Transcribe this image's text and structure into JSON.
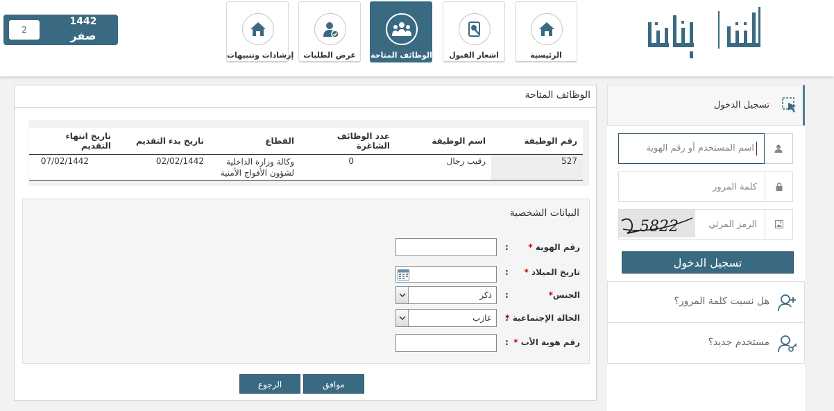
{
  "header": {
    "date": {
      "count": "2",
      "year": "1442",
      "month": "صفر"
    },
    "logo_text": "أبشر توظيف",
    "nav": [
      {
        "label": "الرئيسية",
        "icon": "home-icon"
      },
      {
        "label": "اشعار القبول",
        "icon": "acceptance-notice-icon"
      },
      {
        "label": "الوظائف المتاحة",
        "icon": "available-jobs-icon",
        "active": true
      },
      {
        "label": "عرض الطلبات",
        "icon": "user-check-icon"
      },
      {
        "label": "إرشادات وتنبيهات",
        "icon": "home-icon"
      }
    ]
  },
  "main": {
    "title": "الوظائف المتاحة",
    "table": {
      "headers": [
        "رقم الوظيفة",
        "اسم الوظيفة",
        "عدد الوظائف الشاغرة",
        "القطاع",
        "تاريخ بدء التقديم",
        "تاريخ انتهاء التقديم"
      ],
      "rows": [
        {
          "job_no": "527",
          "job_name": "رقيب رجال",
          "vacancies": "0",
          "sector": "وكالة وزارة الداخلية لشؤون الأفواج الأمنية",
          "start": "02/02/1442",
          "end": "07/02/1442"
        }
      ]
    },
    "personal": {
      "title": "البيانات الشخصية",
      "colon": ":",
      "required_mark": "*",
      "fields": {
        "id": {
          "label": "رقم الهوية",
          "value": ""
        },
        "birth": {
          "label": "تاريخ الميلاد",
          "value": ""
        },
        "gender": {
          "label": "الجنس",
          "value": "ذكر"
        },
        "marital": {
          "label": "الحالة الإجتماعية",
          "value": "عازب"
        },
        "father_id": {
          "label": "رقم هوية الأب",
          "value": ""
        }
      }
    },
    "buttons": {
      "ok": "موافق",
      "back": "الرجوع"
    }
  },
  "login": {
    "title": "تسجيل الدخول",
    "username_placeholder": "اسم المستخدم أو رقم الهوية",
    "password_placeholder": "كلمة المرور",
    "captcha_placeholder": "الرمز المرئي",
    "captcha_text": "5822",
    "button": "تسجيل الدخول",
    "forgot": "هل نسيت كلمة المرور؟",
    "new_user": "مستخدم جديد؟"
  },
  "colors": {
    "primary": "#3a6a82",
    "required": "#cc0000"
  }
}
